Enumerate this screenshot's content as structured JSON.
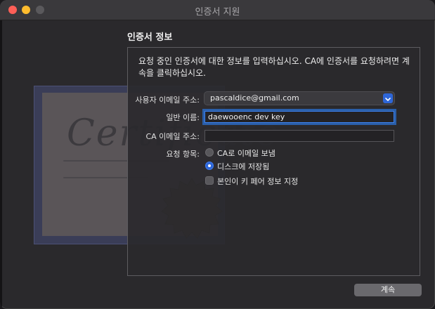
{
  "window": {
    "title": "인증서 지원"
  },
  "section": {
    "heading": "인증서 정보"
  },
  "intro_text": "요청 중인 인증서에 대한 정보를 입력하십시오. CA에 인증서를 요청하려면 계속을 클릭하십시오.",
  "illustration": {
    "script_text": "Certificate"
  },
  "form": {
    "user_email_label": "사용자 이메일 주소:",
    "user_email_value": "pascaldice@gmail.com",
    "common_name_label": "일반 이름:",
    "common_name_value": "daewooenc dev key",
    "ca_email_label": "CA 이메일 주소:",
    "ca_email_value": "",
    "request_label": "요청 항목:",
    "option_email_ca": "CA로 이메일 보냄",
    "option_save_disk": "디스크에 저장됨",
    "option_keypair": "본인이 키 페어 정보 지정",
    "selected_option": "option_save_disk"
  },
  "buttons": {
    "continue": "계속"
  },
  "colors": {
    "accent": "#2e66d8",
    "focus_ring": "#3d82f0"
  }
}
